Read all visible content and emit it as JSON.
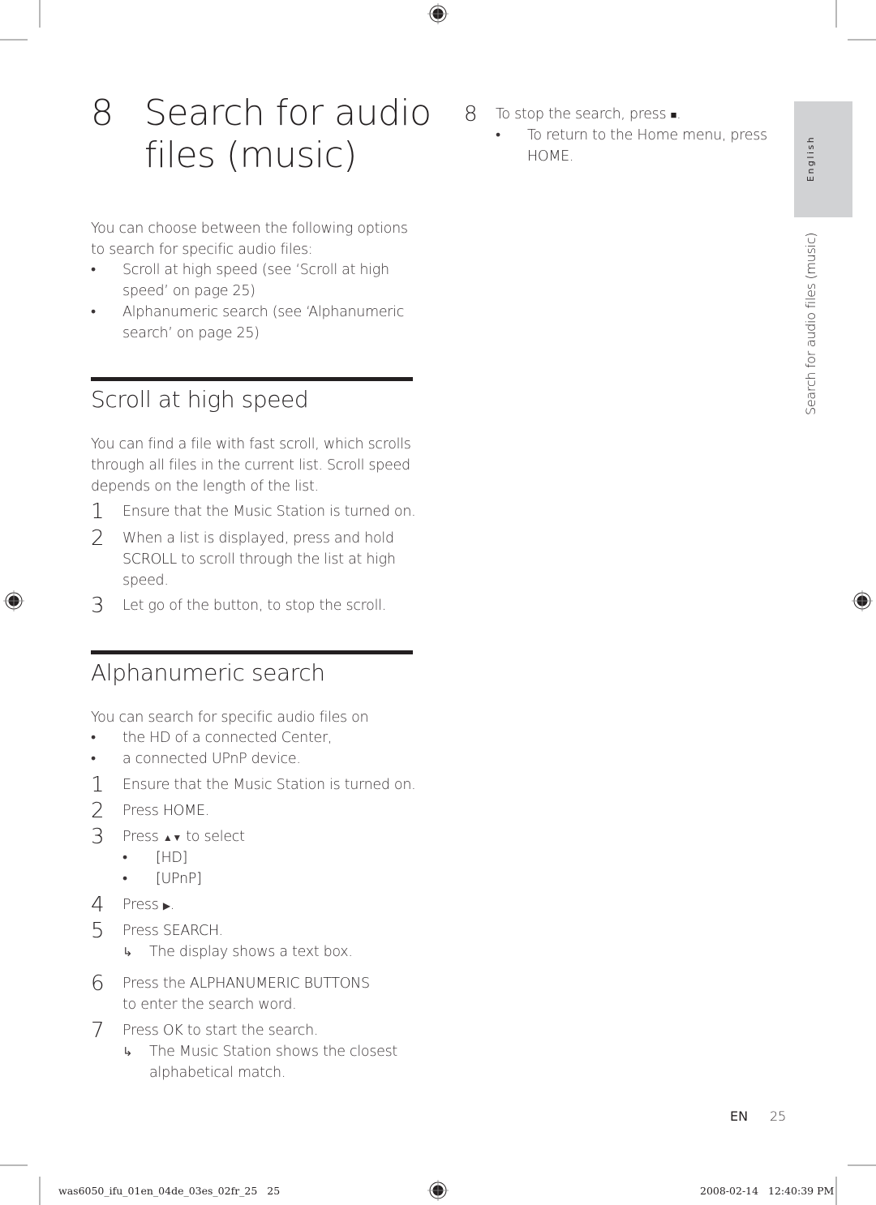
{
  "chapter": {
    "number": "8",
    "title": "Search for audio files (music)",
    "title_line1": "Search for audio",
    "title_line2": "files (music)"
  },
  "intro": {
    "text_line1": "You can choose between the following options",
    "text_line2": "to search for specific audio files:",
    "bullets": [
      {
        "line1": "Scroll at high speed (see ‘Scroll at high",
        "line2": "speed’ on page 25)"
      },
      {
        "line1": "Alphanumeric search (see ‘Alphanumeric",
        "line2": "search’ on page 25)"
      }
    ],
    "bullet_glyph": "•"
  },
  "scroll_section": {
    "heading": "Scroll at high speed",
    "para_lines": [
      "You can find a file with fast scroll, which scrolls",
      "through all files in the current list. Scroll speed",
      "depends on the length of the list."
    ],
    "steps": [
      {
        "num": "1",
        "lines": [
          "Ensure that the Music Station is turned on."
        ]
      },
      {
        "num": "2",
        "line1": "When a list is displayed, press and hold",
        "key": "SCROLL",
        "line2_rest": " to scroll through the list at high",
        "line3": "speed."
      },
      {
        "num": "3",
        "lines": [
          "Let go of the button, to stop the scroll."
        ]
      }
    ]
  },
  "alpha_section": {
    "heading": "Alphanumeric search",
    "intro": "You can search for specific audio files on",
    "bullets": [
      "the HD of a connected Center,",
      "a connected UPnP device."
    ],
    "steps": {
      "s1": {
        "num": "1",
        "text": "Ensure that the Music Station is turned on."
      },
      "s2": {
        "num": "2",
        "pre": "Press ",
        "key": "HOME",
        "post": "."
      },
      "s3": {
        "num": "3",
        "pre": "Press ",
        "icon": "▲▼",
        "post": " to select",
        "options": [
          "[HD]",
          "[UPnP]"
        ]
      },
      "s4": {
        "num": "4",
        "pre": "Press ",
        "icon": "▶",
        "post": "."
      },
      "s5": {
        "num": "5",
        "pre": "Press ",
        "key": "SEARCH",
        "post": ".",
        "result": "The display shows a text box."
      },
      "s6": {
        "num": "6",
        "pre": "Press the ",
        "key": "ALPHANUMERIC BUTTONS",
        "line2": "to enter the search word."
      },
      "s7": {
        "num": "7",
        "pre": "Press ",
        "key": "OK",
        "post": " to start the search.",
        "result_line1": "The Music Station shows the closest",
        "result_line2": "alphabetical match."
      }
    },
    "arrow_glyph": "↳"
  },
  "right_column": {
    "step8": {
      "num": "8",
      "pre": "To stop the search, press ",
      "icon": "■",
      "post": "."
    },
    "bullet": {
      "pre": "To return to the Home menu, press",
      "key": "HOME",
      "post": "."
    }
  },
  "side_tab": {
    "language": "English",
    "chapter_label": "Search for audio files (music)",
    "tab_color": "#d1d2d4"
  },
  "page_footer": {
    "lang": "EN",
    "page": "25"
  },
  "print_slug": {
    "file": "was6050_ifu_01en_04de_03es_02fr_25   25",
    "timestamp": "2008-02-14   12:40:39 PM"
  }
}
